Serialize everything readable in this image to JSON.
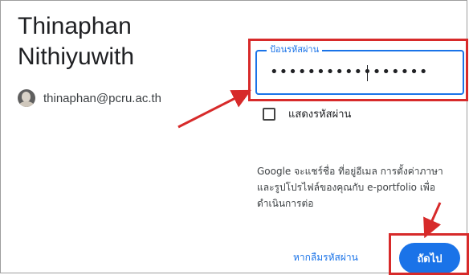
{
  "account": {
    "name_line1": "Thinaphan",
    "name_line2": "Nithiyuwith",
    "email": "thinaphan@pcru.ac.th",
    "avatar_icon": "user-avatar"
  },
  "password": {
    "label": "ป้อนรหัสผ่าน",
    "masked_value": "•••••••••••••••••"
  },
  "show_password": {
    "label": "แสดงรหัสผ่าน",
    "checked": false
  },
  "info_text": "Google จะแชร์ชื่อ ที่อยู่อีเมล การตั้งค่าภาษา และรูปโปรไฟล์ของคุณกับ e-portfolio เพื่อดำเนินการต่อ",
  "actions": {
    "forgot_label": "หากลืมรหัสผ่าน",
    "next_label": "ถัดไป"
  },
  "colors": {
    "accent": "#1a73e8",
    "annotation": "#d72a2a"
  }
}
